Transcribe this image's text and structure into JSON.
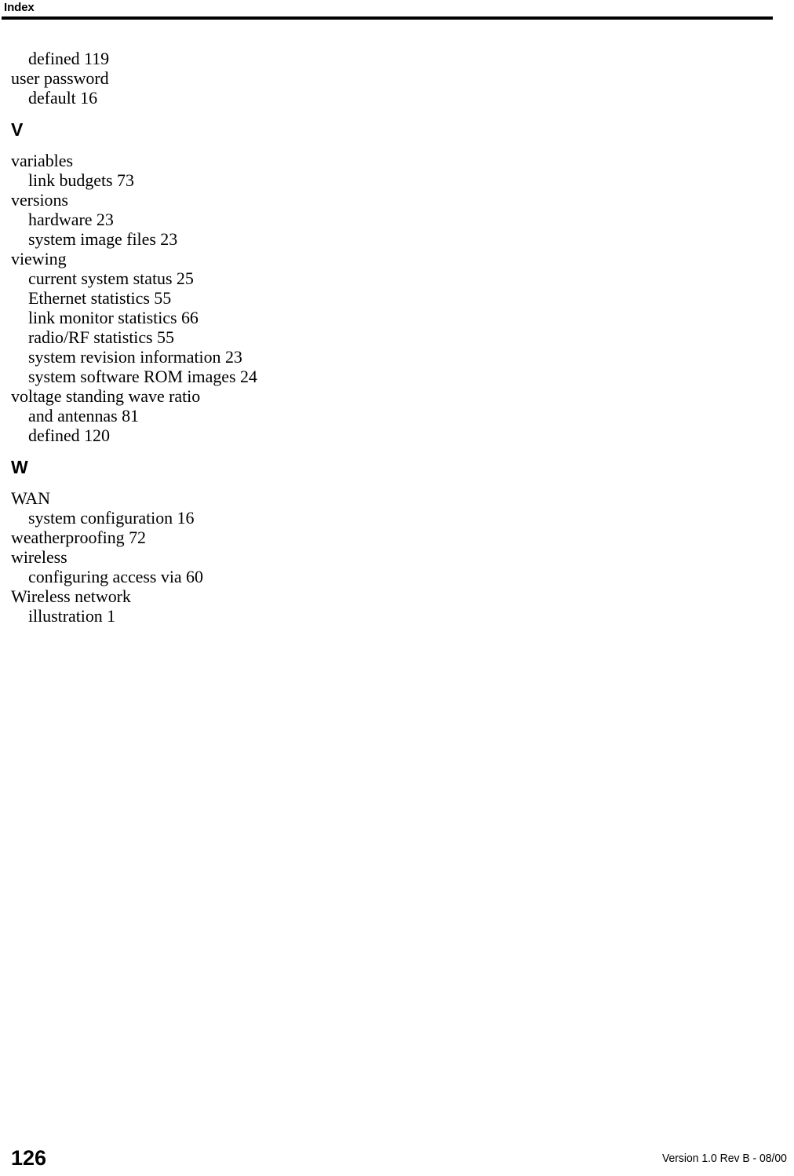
{
  "document": {
    "header": {
      "title": "Index",
      "rule_color": "#000000"
    },
    "footer": {
      "page_number": "126",
      "version": "Version 1.0 Rev B - 08/00"
    },
    "text_color": "#000000",
    "background_color": "#ffffff"
  },
  "index": {
    "blocks": [
      {
        "type": "entries",
        "lines": [
          {
            "level": 2,
            "text": "defined 119"
          },
          {
            "level": 1,
            "text": "user password"
          },
          {
            "level": 2,
            "text": "default 16"
          }
        ]
      },
      {
        "type": "section",
        "letter": "V"
      },
      {
        "type": "entries",
        "lines": [
          {
            "level": 1,
            "text": "variables"
          },
          {
            "level": 2,
            "text": "link budgets 73"
          },
          {
            "level": 1,
            "text": "versions"
          },
          {
            "level": 2,
            "text": "hardware 23"
          },
          {
            "level": 2,
            "text": "system image files 23"
          },
          {
            "level": 1,
            "text": "viewing"
          },
          {
            "level": 2,
            "text": "current system status 25"
          },
          {
            "level": 2,
            "text": "Ethernet statistics 55"
          },
          {
            "level": 2,
            "text": "link monitor statistics 66"
          },
          {
            "level": 2,
            "text": "radio/RF statistics 55"
          },
          {
            "level": 2,
            "text": "system revision information 23"
          },
          {
            "level": 2,
            "text": "system software ROM images 24"
          },
          {
            "level": 1,
            "text": "voltage standing wave ratio"
          },
          {
            "level": 2,
            "text": "and antennas 81"
          },
          {
            "level": 2,
            "text": "defined 120"
          }
        ]
      },
      {
        "type": "section",
        "letter": "W"
      },
      {
        "type": "entries",
        "lines": [
          {
            "level": 1,
            "text": "WAN"
          },
          {
            "level": 2,
            "text": "system configuration 16"
          },
          {
            "level": 1,
            "text": "weatherproofing 72"
          },
          {
            "level": 1,
            "text": "wireless"
          },
          {
            "level": 2,
            "text": "configuring access via 60"
          },
          {
            "level": 1,
            "text": "Wireless network"
          },
          {
            "level": 2,
            "text": "illustration 1"
          }
        ]
      }
    ]
  }
}
